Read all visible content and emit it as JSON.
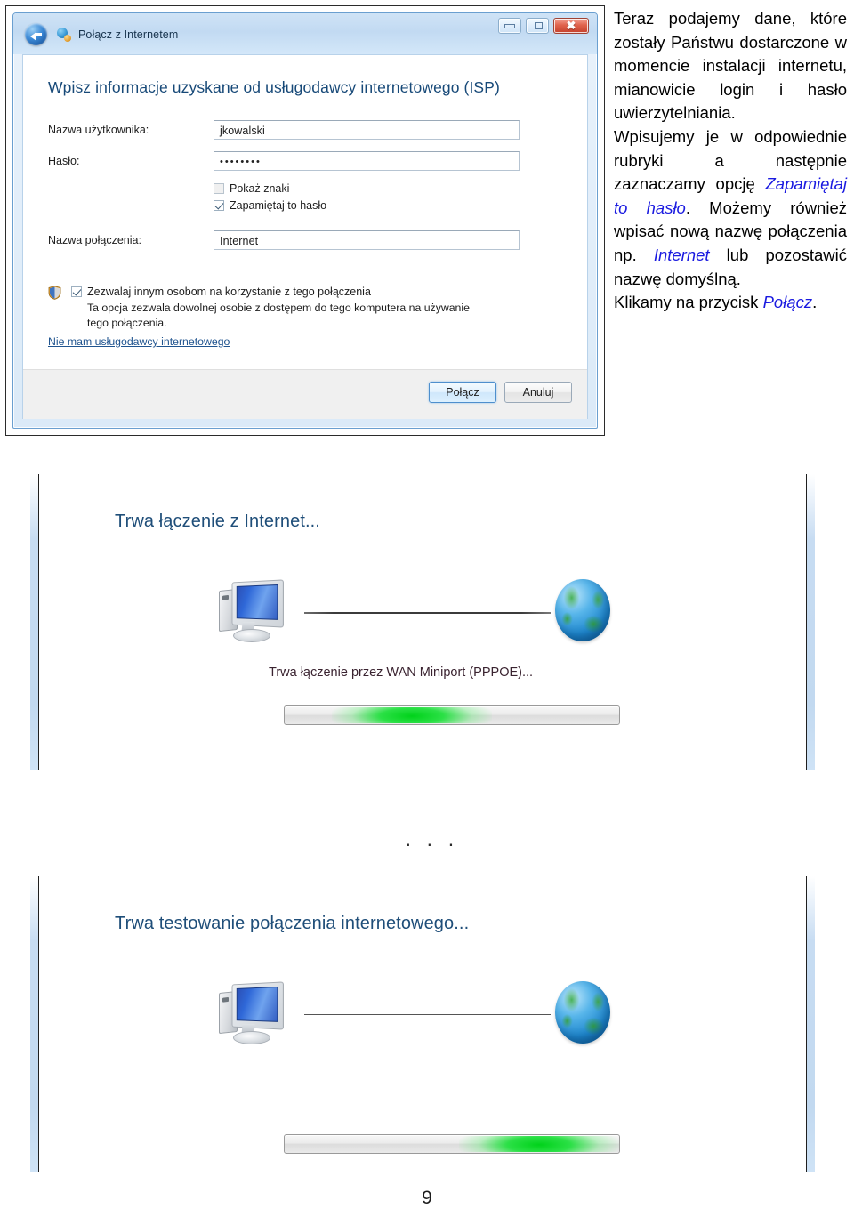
{
  "figure1": {
    "window_title": "Połącz z Internetem",
    "titlebar_buttons": {
      "minimize": "minimize-icon",
      "maximize": "maximize-icon",
      "close": "✖"
    },
    "heading": "Wpisz informacje uzyskane od usługodawcy internetowego (ISP)",
    "fields": [
      {
        "label": "Nazwa użytkownika:",
        "value": "jkowalski"
      },
      {
        "label": "Hasło:",
        "value": "••••••••"
      },
      {
        "label": "Nazwa połączenia:",
        "value": "Internet"
      }
    ],
    "checkboxes": [
      {
        "label": "Pokaż znaki",
        "checked": false
      },
      {
        "label": "Zapamiętaj to hasło",
        "checked": true
      }
    ],
    "allow_others": {
      "label": "Zezwalaj innym osobom na korzystanie z tego połączenia",
      "checked": true,
      "description": "Ta opcja zezwala dowolnej osobie z dostępem do tego komputera na używanie tego połączenia.",
      "link": "Nie mam usługodawcy internetowego"
    },
    "buttons": {
      "connect": "Połącz",
      "cancel": "Anuluj"
    }
  },
  "figure2": {
    "title": "Trwa łączenie z Internet...",
    "status": "Trwa łączenie przez WAN Miniport (PPPOE)...",
    "progress_position_percent": 28
  },
  "separator": "· · ·",
  "figure3": {
    "title": "Trwa testowanie połączenia internetowego...",
    "progress_position_percent": 60
  },
  "sidetext": {
    "p1_part1": "Teraz podajemy dane, które zostały Państwu dostarczone w momencie instalacji internetu, mianowicie login i hasło uwierzytelniania.",
    "p2_part1": "Wpisujemy je w odpowiednie rubryki a następnie zaznaczamy opcję ",
    "p2_em1": "Zapamiętaj to hasło",
    "p2_part2": ". Możemy również wpisać nową nazwę połączenia np. ",
    "p2_em2": "Internet",
    "p2_part3": " lub pozostawić nazwę domyślną.",
    "p3_part1": "Klikamy na przycisk ",
    "p3_em1": "Połącz",
    "p3_part2": "."
  },
  "page_number": "9",
  "colors": {
    "accent_blue": "#1a1ae0",
    "heading_blue": "#174978",
    "panel_title_blue": "#1f4e79",
    "progress_green": "#00d21a"
  }
}
